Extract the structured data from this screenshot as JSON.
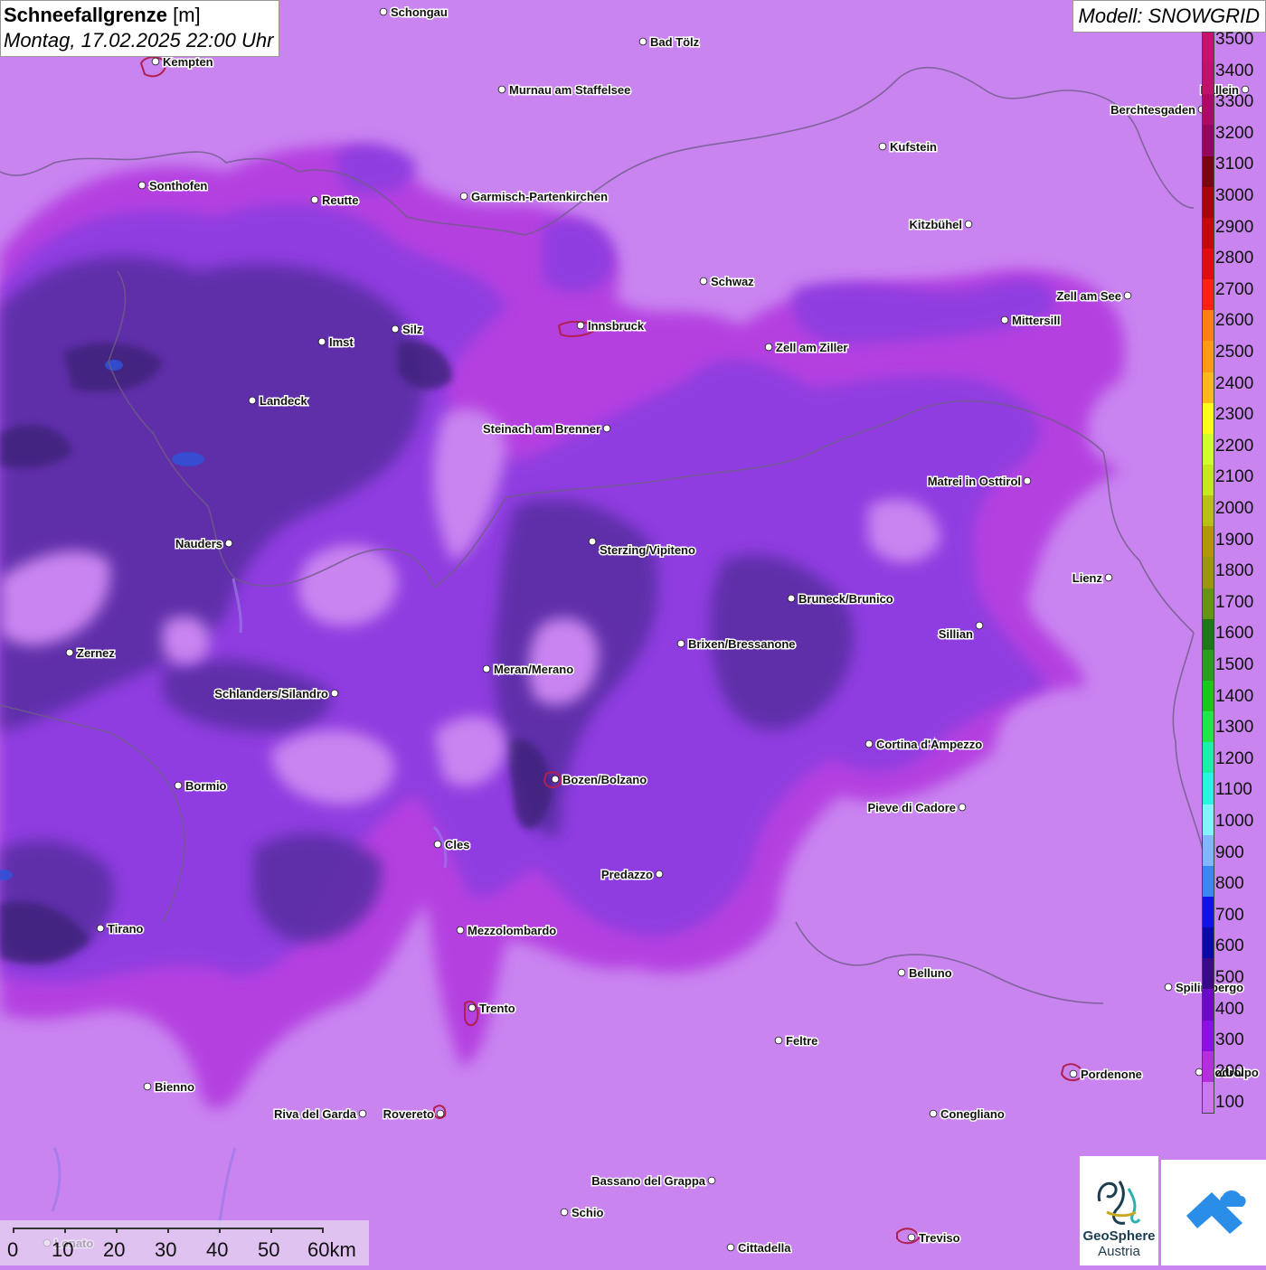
{
  "title": {
    "main": "Schneefallgrenze",
    "unit": "[m]",
    "datetime": "Montag, 17.02.2025 22:00 Uhr"
  },
  "model": "Modell: SNOWGRID",
  "legend": {
    "labels": [
      "3500",
      "3400",
      "3300",
      "3200",
      "3100",
      "3000",
      "2900",
      "2800",
      "2700",
      "2600",
      "2500",
      "2400",
      "2300",
      "2200",
      "2100",
      "2000",
      "1900",
      "1800",
      "1700",
      "1600",
      "1500",
      "1400",
      "1300",
      "1200",
      "1100",
      "1000",
      "900",
      "800",
      "700",
      "600",
      "500",
      "400",
      "300",
      "200",
      "100"
    ],
    "colors": [
      "#c8106e",
      "#c0126a",
      "#ad0a68",
      "#940760",
      "#7a0512",
      "#a8060c",
      "#c5080c",
      "#e20b0f",
      "#ff2212",
      "#ff7f14",
      "#ff9a16",
      "#ffb81c",
      "#ffff1a",
      "#cfff2c",
      "#c5e81e",
      "#b8c016",
      "#b3960c",
      "#9b960e",
      "#649614",
      "#1e7818",
      "#2a9e1e",
      "#1cc71c",
      "#21e64a",
      "#1af0a8",
      "#28f5df",
      "#82f4ff",
      "#80b7ff",
      "#3c86f2",
      "#1010e8",
      "#0a0aa6",
      "#3a0a86",
      "#6c08c8",
      "#8a10e6",
      "#b330dc",
      "#c978f0"
    ]
  },
  "scalebar": {
    "labels": [
      "0",
      "10",
      "20",
      "30",
      "40",
      "50",
      "60km"
    ]
  },
  "logos": {
    "geosphere_line1": "GeoSphere",
    "geosphere_line2": "Austria",
    "geosphere_icon": "geosphere-logo-icon",
    "partner_icon": "cloud-partner-logo-icon"
  },
  "cities": [
    {
      "name": "Schongau"
    },
    {
      "name": "Bad Tölz"
    },
    {
      "name": "Kempten"
    },
    {
      "name": "Murnau am Staffelsee"
    },
    {
      "name": "Hallein"
    },
    {
      "name": "Berchtesgaden"
    },
    {
      "name": "Kufstein"
    },
    {
      "name": "Sonthofen"
    },
    {
      "name": "Reutte"
    },
    {
      "name": "Garmisch-Partenkirchen"
    },
    {
      "name": "Kitzbühel"
    },
    {
      "name": "Schwaz"
    },
    {
      "name": "Zell am See"
    },
    {
      "name": "Mittersill"
    },
    {
      "name": "Innsbruck"
    },
    {
      "name": "Imst"
    },
    {
      "name": "Silz"
    },
    {
      "name": "Zell am Ziller"
    },
    {
      "name": "Landeck"
    },
    {
      "name": "Steinach am Brenner"
    },
    {
      "name": "Matrei in Osttirol"
    },
    {
      "name": "Nauders"
    },
    {
      "name": "Sterzing/Vipiteno"
    },
    {
      "name": "Lienz"
    },
    {
      "name": "Bruneck/Brunico"
    },
    {
      "name": "Sillian"
    },
    {
      "name": "Zernez"
    },
    {
      "name": "Brixen/Bressanone"
    },
    {
      "name": "Meran/Merano"
    },
    {
      "name": "Schlanders/Silandro"
    },
    {
      "name": "Cortina d'Ampezzo"
    },
    {
      "name": "Bozen/Bolzano"
    },
    {
      "name": "Bormio"
    },
    {
      "name": "Pieve di Cadore"
    },
    {
      "name": "Cles"
    },
    {
      "name": "Predazzo"
    },
    {
      "name": "Tirano"
    },
    {
      "name": "Mezzolombardo"
    },
    {
      "name": "Belluno"
    },
    {
      "name": "Spilimbergo"
    },
    {
      "name": "Trento"
    },
    {
      "name": "Feltre"
    },
    {
      "name": "Pordenone"
    },
    {
      "name": "Codroipo"
    },
    {
      "name": "Bienno"
    },
    {
      "name": "Riva del Garda"
    },
    {
      "name": "Rovereto"
    },
    {
      "name": "Conegliano"
    },
    {
      "name": "Bassano del Grappa"
    },
    {
      "name": "Schio"
    },
    {
      "name": "Lonato"
    },
    {
      "name": "Treviso"
    },
    {
      "name": "Cittadella"
    }
  ]
}
